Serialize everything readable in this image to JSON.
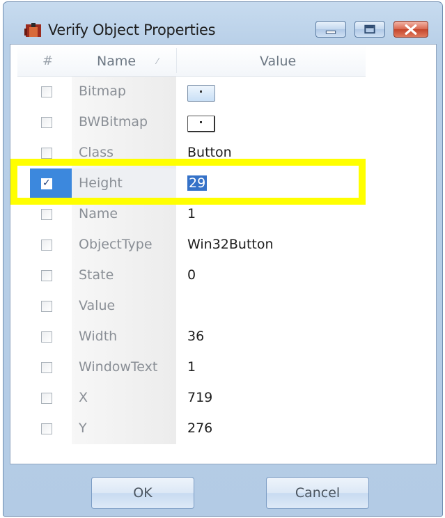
{
  "window": {
    "title": "Verify Object Properties"
  },
  "table": {
    "headers": {
      "check": "#",
      "name": "Name",
      "sort_indicator": "⁄",
      "value": "Value"
    },
    "rows": [
      {
        "name": "Bitmap",
        "value": "",
        "checked": false,
        "kind": "bitmap"
      },
      {
        "name": "BWBitmap",
        "value": "",
        "checked": false,
        "kind": "bwbitmap"
      },
      {
        "name": "Class",
        "value": "Button",
        "checked": false,
        "kind": "text"
      },
      {
        "name": "Height",
        "value": "29",
        "checked": true,
        "kind": "text",
        "selected": true
      },
      {
        "name": "Name",
        "value": "1",
        "checked": false,
        "kind": "text"
      },
      {
        "name": "ObjectType",
        "value": "Win32Button",
        "checked": false,
        "kind": "text"
      },
      {
        "name": "State",
        "value": "0",
        "checked": false,
        "kind": "text"
      },
      {
        "name": "Value",
        "value": "",
        "checked": false,
        "kind": "text"
      },
      {
        "name": "Width",
        "value": "36",
        "checked": false,
        "kind": "text"
      },
      {
        "name": "WindowText",
        "value": "1",
        "checked": false,
        "kind": "text"
      },
      {
        "name": "X",
        "value": "719",
        "checked": false,
        "kind": "text"
      },
      {
        "name": "Y",
        "value": "276",
        "checked": false,
        "kind": "text"
      }
    ]
  },
  "buttons": {
    "ok": "OK",
    "cancel": "Cancel"
  },
  "colors": {
    "selection": "#3c88dd",
    "highlight_frame": "#ffff00"
  }
}
